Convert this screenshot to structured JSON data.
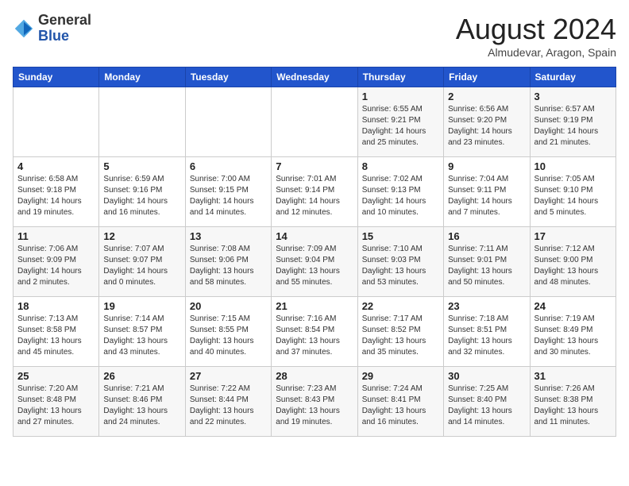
{
  "header": {
    "logo_general": "General",
    "logo_blue": "Blue",
    "month_title": "August 2024",
    "location": "Almudevar, Aragon, Spain"
  },
  "weekdays": [
    "Sunday",
    "Monday",
    "Tuesday",
    "Wednesday",
    "Thursday",
    "Friday",
    "Saturday"
  ],
  "weeks": [
    [
      {
        "day": "",
        "detail": ""
      },
      {
        "day": "",
        "detail": ""
      },
      {
        "day": "",
        "detail": ""
      },
      {
        "day": "",
        "detail": ""
      },
      {
        "day": "1",
        "detail": "Sunrise: 6:55 AM\nSunset: 9:21 PM\nDaylight: 14 hours\nand 25 minutes."
      },
      {
        "day": "2",
        "detail": "Sunrise: 6:56 AM\nSunset: 9:20 PM\nDaylight: 14 hours\nand 23 minutes."
      },
      {
        "day": "3",
        "detail": "Sunrise: 6:57 AM\nSunset: 9:19 PM\nDaylight: 14 hours\nand 21 minutes."
      }
    ],
    [
      {
        "day": "4",
        "detail": "Sunrise: 6:58 AM\nSunset: 9:18 PM\nDaylight: 14 hours\nand 19 minutes."
      },
      {
        "day": "5",
        "detail": "Sunrise: 6:59 AM\nSunset: 9:16 PM\nDaylight: 14 hours\nand 16 minutes."
      },
      {
        "day": "6",
        "detail": "Sunrise: 7:00 AM\nSunset: 9:15 PM\nDaylight: 14 hours\nand 14 minutes."
      },
      {
        "day": "7",
        "detail": "Sunrise: 7:01 AM\nSunset: 9:14 PM\nDaylight: 14 hours\nand 12 minutes."
      },
      {
        "day": "8",
        "detail": "Sunrise: 7:02 AM\nSunset: 9:13 PM\nDaylight: 14 hours\nand 10 minutes."
      },
      {
        "day": "9",
        "detail": "Sunrise: 7:04 AM\nSunset: 9:11 PM\nDaylight: 14 hours\nand 7 minutes."
      },
      {
        "day": "10",
        "detail": "Sunrise: 7:05 AM\nSunset: 9:10 PM\nDaylight: 14 hours\nand 5 minutes."
      }
    ],
    [
      {
        "day": "11",
        "detail": "Sunrise: 7:06 AM\nSunset: 9:09 PM\nDaylight: 14 hours\nand 2 minutes."
      },
      {
        "day": "12",
        "detail": "Sunrise: 7:07 AM\nSunset: 9:07 PM\nDaylight: 14 hours\nand 0 minutes."
      },
      {
        "day": "13",
        "detail": "Sunrise: 7:08 AM\nSunset: 9:06 PM\nDaylight: 13 hours\nand 58 minutes."
      },
      {
        "day": "14",
        "detail": "Sunrise: 7:09 AM\nSunset: 9:04 PM\nDaylight: 13 hours\nand 55 minutes."
      },
      {
        "day": "15",
        "detail": "Sunrise: 7:10 AM\nSunset: 9:03 PM\nDaylight: 13 hours\nand 53 minutes."
      },
      {
        "day": "16",
        "detail": "Sunrise: 7:11 AM\nSunset: 9:01 PM\nDaylight: 13 hours\nand 50 minutes."
      },
      {
        "day": "17",
        "detail": "Sunrise: 7:12 AM\nSunset: 9:00 PM\nDaylight: 13 hours\nand 48 minutes."
      }
    ],
    [
      {
        "day": "18",
        "detail": "Sunrise: 7:13 AM\nSunset: 8:58 PM\nDaylight: 13 hours\nand 45 minutes."
      },
      {
        "day": "19",
        "detail": "Sunrise: 7:14 AM\nSunset: 8:57 PM\nDaylight: 13 hours\nand 43 minutes."
      },
      {
        "day": "20",
        "detail": "Sunrise: 7:15 AM\nSunset: 8:55 PM\nDaylight: 13 hours\nand 40 minutes."
      },
      {
        "day": "21",
        "detail": "Sunrise: 7:16 AM\nSunset: 8:54 PM\nDaylight: 13 hours\nand 37 minutes."
      },
      {
        "day": "22",
        "detail": "Sunrise: 7:17 AM\nSunset: 8:52 PM\nDaylight: 13 hours\nand 35 minutes."
      },
      {
        "day": "23",
        "detail": "Sunrise: 7:18 AM\nSunset: 8:51 PM\nDaylight: 13 hours\nand 32 minutes."
      },
      {
        "day": "24",
        "detail": "Sunrise: 7:19 AM\nSunset: 8:49 PM\nDaylight: 13 hours\nand 30 minutes."
      }
    ],
    [
      {
        "day": "25",
        "detail": "Sunrise: 7:20 AM\nSunset: 8:48 PM\nDaylight: 13 hours\nand 27 minutes."
      },
      {
        "day": "26",
        "detail": "Sunrise: 7:21 AM\nSunset: 8:46 PM\nDaylight: 13 hours\nand 24 minutes."
      },
      {
        "day": "27",
        "detail": "Sunrise: 7:22 AM\nSunset: 8:44 PM\nDaylight: 13 hours\nand 22 minutes."
      },
      {
        "day": "28",
        "detail": "Sunrise: 7:23 AM\nSunset: 8:43 PM\nDaylight: 13 hours\nand 19 minutes."
      },
      {
        "day": "29",
        "detail": "Sunrise: 7:24 AM\nSunset: 8:41 PM\nDaylight: 13 hours\nand 16 minutes."
      },
      {
        "day": "30",
        "detail": "Sunrise: 7:25 AM\nSunset: 8:40 PM\nDaylight: 13 hours\nand 14 minutes."
      },
      {
        "day": "31",
        "detail": "Sunrise: 7:26 AM\nSunset: 8:38 PM\nDaylight: 13 hours\nand 11 minutes."
      }
    ]
  ]
}
